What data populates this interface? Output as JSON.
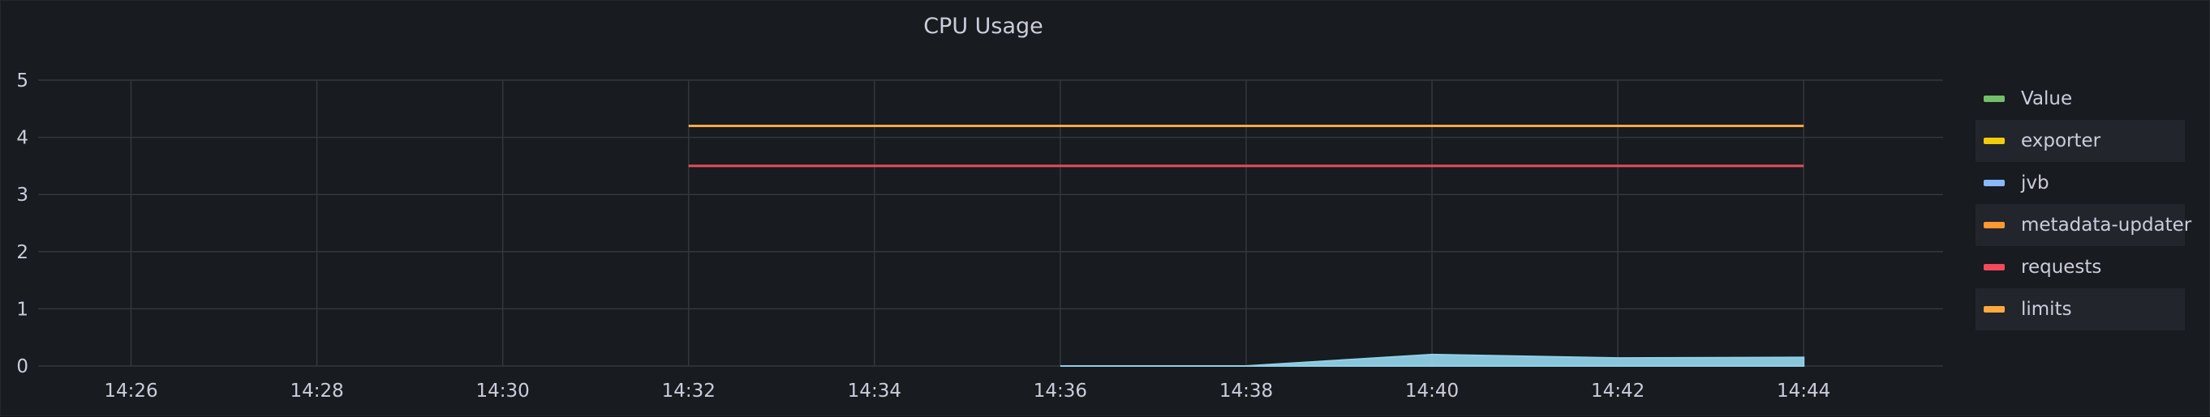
{
  "panel": {
    "title": "CPU Usage"
  },
  "chart_data": {
    "type": "line",
    "title": "CPU Usage",
    "xlabel": "",
    "ylabel": "",
    "x_ticks": [
      "14:26",
      "14:28",
      "14:30",
      "14:32",
      "14:34",
      "14:36",
      "14:38",
      "14:40",
      "14:42",
      "14:44"
    ],
    "y_ticks": [
      0,
      1,
      2,
      3,
      4,
      5
    ],
    "xlim": [
      "14:25",
      "14:45:30"
    ],
    "ylim": [
      0,
      5
    ],
    "grid": true,
    "legend_position": "right",
    "series": [
      {
        "name": "Value",
        "color": "#73bf69",
        "style": "line",
        "points": []
      },
      {
        "name": "exporter",
        "color": "#fade2a",
        "style": "line",
        "points": []
      },
      {
        "name": "jvb",
        "color": "#8ab8ff",
        "style": "area",
        "points": [
          {
            "x": "14:36",
            "y": 0.0
          },
          {
            "x": "14:38",
            "y": 0.0
          },
          {
            "x": "14:40",
            "y": 0.2
          },
          {
            "x": "14:42",
            "y": 0.14
          },
          {
            "x": "14:44",
            "y": 0.15
          }
        ]
      },
      {
        "name": "metadata-updater",
        "color": "#ff9830",
        "style": "line",
        "points": []
      },
      {
        "name": "requests",
        "color": "#f2495c",
        "style": "line",
        "points": [
          {
            "x": "14:32",
            "y": 3.5
          },
          {
            "x": "14:44",
            "y": 3.5
          }
        ]
      },
      {
        "name": "limits",
        "color": "#ffa940",
        "style": "line",
        "points": [
          {
            "x": "14:32",
            "y": 4.2
          },
          {
            "x": "14:44",
            "y": 4.2
          }
        ]
      }
    ]
  },
  "legend": {
    "items": [
      {
        "label": "Value",
        "color": "#73bf69"
      },
      {
        "label": "exporter",
        "color": "#f2cc0c"
      },
      {
        "label": "jvb",
        "color": "#8ab8ff"
      },
      {
        "label": "metadata-updater",
        "color": "#ff9830"
      },
      {
        "label": "requests",
        "color": "#f2495c"
      },
      {
        "label": "limits",
        "color": "#ffa940"
      }
    ]
  },
  "colors": {
    "jvb_fill": "#8fd0e6",
    "limits_line": "#f5a84a",
    "requests_line": "#e2505c",
    "grid": "#34373d",
    "text": "#ccccdc"
  }
}
